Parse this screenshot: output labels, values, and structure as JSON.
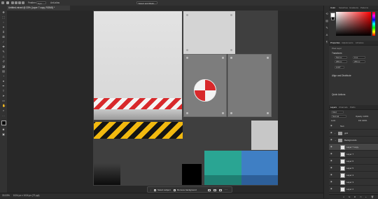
{
  "options_bar": {
    "feather_label": "Feather:",
    "feather_value": "0 px",
    "anti_alias_label": "Anti-alias",
    "select_mask_label": "Select and Mask..."
  },
  "document": {
    "tab_title": "Untitled-mixed @ 33% (Layer 7 copy, RGB/8) *"
  },
  "status_bar": {
    "zoom": "33.33%",
    "doc_info": "1024 px x 1024 px (72 ppi)"
  },
  "context_bar": {
    "select_subject_label": "Select subject",
    "remove_background_label": "Remove background"
  },
  "color_panel": {
    "tabs": [
      "Color",
      "Swatches",
      "Gradients",
      "Patterns"
    ],
    "active_tab": "Color",
    "hue_color": "#ff0000"
  },
  "properties_panel": {
    "tabs": [
      "Properties",
      "Adjustments",
      "Libraries"
    ],
    "active_tab": "Properties",
    "layer_type": "Pixel Layer",
    "transform_label": "Transform",
    "w_value": "512 px",
    "h_value": "256 px",
    "x_value": "0 px",
    "y_value": "256 px",
    "angle_value": "0.00°",
    "align_label": "Align and Distribute",
    "quick_actions_label": "Quick Actions"
  },
  "layers_panel": {
    "tabs": [
      "Layers",
      "Channels",
      "Paths"
    ],
    "active_tab": "Layers",
    "filter_label": "Kind",
    "mode_label": "Normal",
    "opacity_label": "Opacity: 100%",
    "lock_label": "Lock:",
    "fill_label": "Fill: 100%",
    "layers": [
      {
        "name": "Text",
        "type": "text",
        "indent": false
      },
      {
        "name": "grid",
        "type": "group",
        "indent": false
      },
      {
        "name": "Backgrounds",
        "type": "group",
        "indent": false
      },
      {
        "name": "Layer 7 copy",
        "type": "pixel",
        "indent": true,
        "selected": true
      },
      {
        "name": "Layer 7",
        "type": "pixel",
        "indent": true
      },
      {
        "name": "Layer 6",
        "type": "pixel",
        "indent": true
      },
      {
        "name": "Layer 5",
        "type": "pixel",
        "indent": true
      },
      {
        "name": "Layer 4",
        "type": "pixel",
        "indent": true
      },
      {
        "name": "Layer 3",
        "type": "pixel",
        "indent": true
      },
      {
        "name": "Layer 2",
        "type": "pixel",
        "indent": true
      },
      {
        "name": "Layer 1",
        "type": "pixel",
        "indent": true
      }
    ]
  },
  "colors": {
    "accent": "#3a7bd5",
    "teal_tile": "#2aa593",
    "blue_tile": "#3f7fc4",
    "hazard_red": "#d8292b",
    "hazard_yellow": "#f2b90f"
  }
}
